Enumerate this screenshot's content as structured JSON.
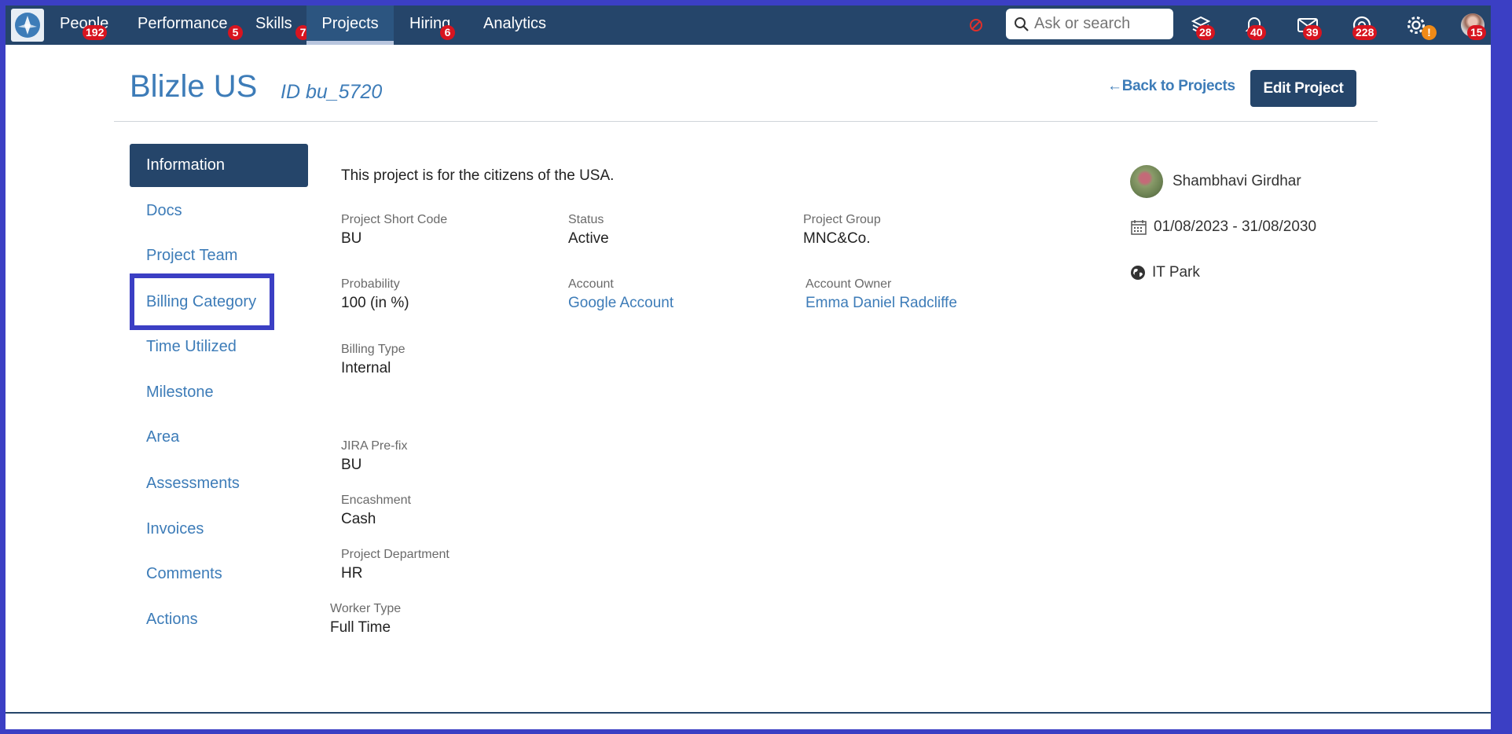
{
  "nav": {
    "items": [
      {
        "label": "People",
        "badge": "192"
      },
      {
        "label": "Performance",
        "badge": "5"
      },
      {
        "label": "Skills",
        "badge": "7"
      },
      {
        "label": "Projects",
        "badge": ""
      },
      {
        "label": "Hiring",
        "badge": "6"
      },
      {
        "label": "Analytics",
        "badge": ""
      }
    ],
    "active": "Projects",
    "search_placeholder": "Ask or search",
    "icons": [
      {
        "name": "stack-icon",
        "badge": "28"
      },
      {
        "name": "bell-icon",
        "badge": "40"
      },
      {
        "name": "mail-icon",
        "badge": "39"
      },
      {
        "name": "support-icon",
        "badge": "228"
      },
      {
        "name": "gear-icon",
        "badge": "!"
      },
      {
        "name": "profile-avatar",
        "badge": "15"
      }
    ]
  },
  "header": {
    "title": "Blizle US",
    "id": "ID bu_5720",
    "back_label": "Back to Projects",
    "edit_label": "Edit Project"
  },
  "sidebar": {
    "items": [
      {
        "label": "Information"
      },
      {
        "label": "Docs"
      },
      {
        "label": "Project Team"
      },
      {
        "label": "Billing Category"
      },
      {
        "label": "Time Utilized"
      },
      {
        "label": "Milestone"
      },
      {
        "label": "Area"
      },
      {
        "label": "Assessments"
      },
      {
        "label": "Invoices"
      },
      {
        "label": "Comments"
      },
      {
        "label": "Actions"
      }
    ],
    "active": "Information",
    "focused": "Billing Category"
  },
  "details": {
    "description": "This project is for the citizens of the USA.",
    "short_code": {
      "label": "Project Short Code",
      "value": "BU"
    },
    "status": {
      "label": "Status",
      "value": "Active"
    },
    "group": {
      "label": "Project Group",
      "value": "MNC&Co."
    },
    "probability": {
      "label": "Probability",
      "value": "100 (in %)"
    },
    "account": {
      "label": "Account",
      "value": "Google Account"
    },
    "account_owner": {
      "label": "Account Owner",
      "value": "Emma Daniel Radcliffe"
    },
    "billing_type": {
      "label": "Billing Type",
      "value": "Internal"
    },
    "jira_prefix": {
      "label": "JIRA Pre-fix",
      "value": "BU"
    },
    "encashment": {
      "label": "Encashment",
      "value": "Cash"
    },
    "department": {
      "label": "Project Department",
      "value": "HR"
    },
    "worker_type": {
      "label": "Worker Type",
      "value": "Full Time"
    }
  },
  "side_info": {
    "manager": "Shambhavi Girdhar",
    "dates": "01/08/2023 - 31/08/2030",
    "location": "IT Park"
  },
  "colors": {
    "nav_bg": "#25456a",
    "accent": "#3d7cb8",
    "badge": "#d8141f",
    "focus": "#3b3fc4"
  }
}
